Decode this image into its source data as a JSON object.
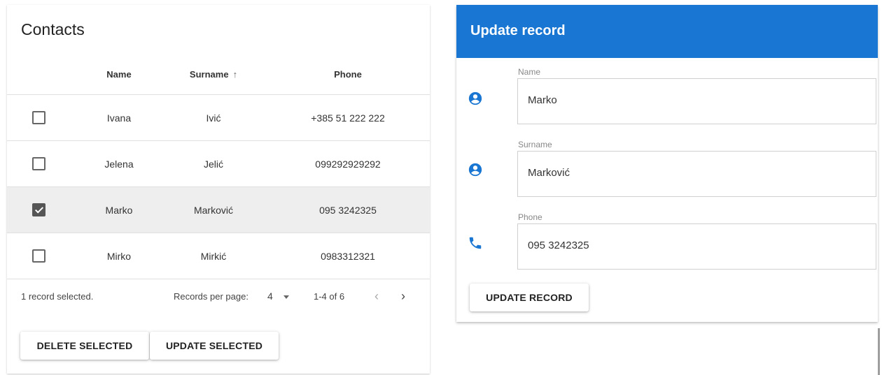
{
  "contacts": {
    "title": "Contacts",
    "columns": {
      "name": "Name",
      "surname": "Surname",
      "phone": "Phone",
      "sort_indicator": "↑"
    },
    "rows": [
      {
        "name": "Ivana",
        "surname": "Ivić",
        "phone": "+385 51 222 222",
        "selected": false
      },
      {
        "name": "Jelena",
        "surname": "Jelić",
        "phone": "099292929292",
        "selected": false
      },
      {
        "name": "Marko",
        "surname": "Marković",
        "phone": "095 3242325",
        "selected": true
      },
      {
        "name": "Mirko",
        "surname": "Mirkić",
        "phone": "0983312321",
        "selected": false
      }
    ],
    "footer": {
      "selected_text": "1 record selected.",
      "rows_per_page_label": "Records per page:",
      "rows_per_page_value": "4",
      "page_range": "1-4 of 6",
      "prev_icon": "‹",
      "next_icon": "›"
    },
    "buttons": {
      "delete": "DELETE SELECTED",
      "update": "UPDATE SELECTED"
    }
  },
  "update_record": {
    "title": "Update record",
    "header_color": "#1976d2",
    "icon_color": "#1976d2",
    "fields": {
      "name": {
        "label": "Name",
        "value": "Marko",
        "icon": "account-circle-icon"
      },
      "surname": {
        "label": "Surname",
        "value": "Marković",
        "icon": "account-circle-icon"
      },
      "phone": {
        "label": "Phone",
        "value": "095 3242325",
        "icon": "phone-icon"
      }
    },
    "button": "UPDATE RECORD"
  }
}
